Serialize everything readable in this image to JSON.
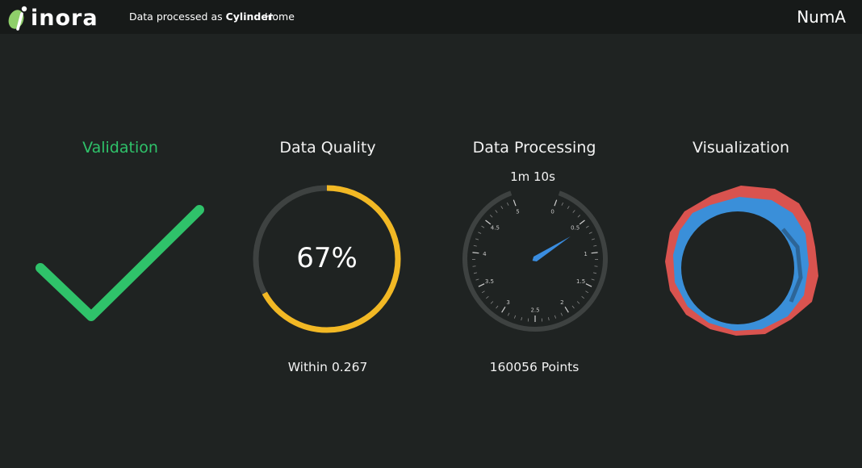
{
  "navbar": {
    "logo_text": "inora",
    "status_prefix": "Data processed as",
    "status_shape": "Cylinder",
    "home_label": "Home",
    "user_name": "NumA"
  },
  "panels": {
    "validation": {
      "title": "Validation",
      "status_color": "#2fc26a"
    },
    "quality": {
      "title": "Data Quality",
      "percent": 67,
      "percent_text": "67%",
      "within_text": "Within 0.267",
      "ring_color": "#f2b824"
    },
    "processing": {
      "title": "Data Processing",
      "elapsed": "1m 10s",
      "dial_labels": [
        "0",
        "0.5",
        "1",
        "1.5",
        "2",
        "2.5",
        "3",
        "3.5",
        "4",
        "4.5",
        "5"
      ],
      "dial_value": 1.17,
      "needle_color": "#3a8de0",
      "points_text": "160056 Points"
    },
    "visualization": {
      "title": "Visualization",
      "outer_color": "#d9534f",
      "inner_color": "#3a8fd9"
    }
  }
}
